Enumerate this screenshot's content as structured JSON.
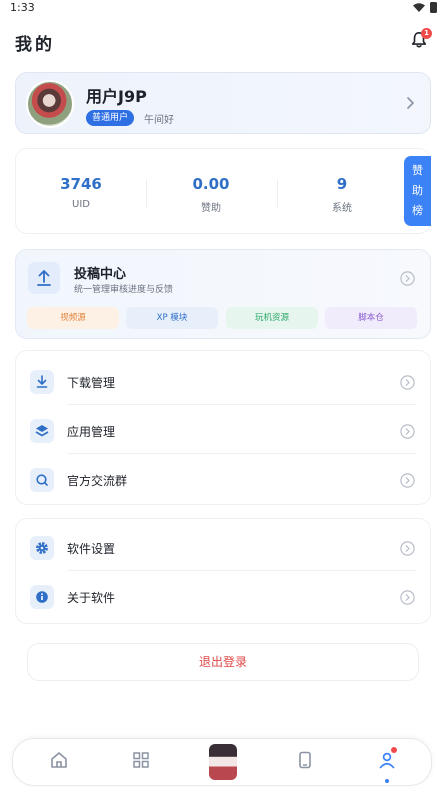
{
  "status_bar": {
    "time": "1:33"
  },
  "header": {
    "title": "我的",
    "notification_count": "1"
  },
  "profile": {
    "name": "用户J9P",
    "badge": "普通用户",
    "greeting": "午间好"
  },
  "stats": [
    {
      "value": "3746",
      "label": "UID"
    },
    {
      "value": "0.00",
      "label": "赞助"
    },
    {
      "value": "9",
      "label": "系统"
    }
  ],
  "sponsor_tab": "赞助榜",
  "submission": {
    "title": "投稿中心",
    "subtitle": "统一管理审核进度与反馈",
    "chips": [
      "视频源",
      "XP 模块",
      "玩机资源",
      "脚本仓"
    ]
  },
  "menu_group_1": [
    {
      "label": "下载管理",
      "icon": "download-icon"
    },
    {
      "label": "应用管理",
      "icon": "layers-icon"
    },
    {
      "label": "官方交流群",
      "icon": "search-icon"
    }
  ],
  "menu_group_2": [
    {
      "label": "软件设置",
      "icon": "gear-icon"
    },
    {
      "label": "关于软件",
      "icon": "info-icon"
    }
  ],
  "logout_label": "退出登录",
  "tabbar": [
    "home-icon",
    "grid-icon",
    "mascot-avatar",
    "phone-icon",
    "profile-icon"
  ],
  "colors": {
    "accent": "#3b82f6",
    "danger": "#e04848"
  }
}
